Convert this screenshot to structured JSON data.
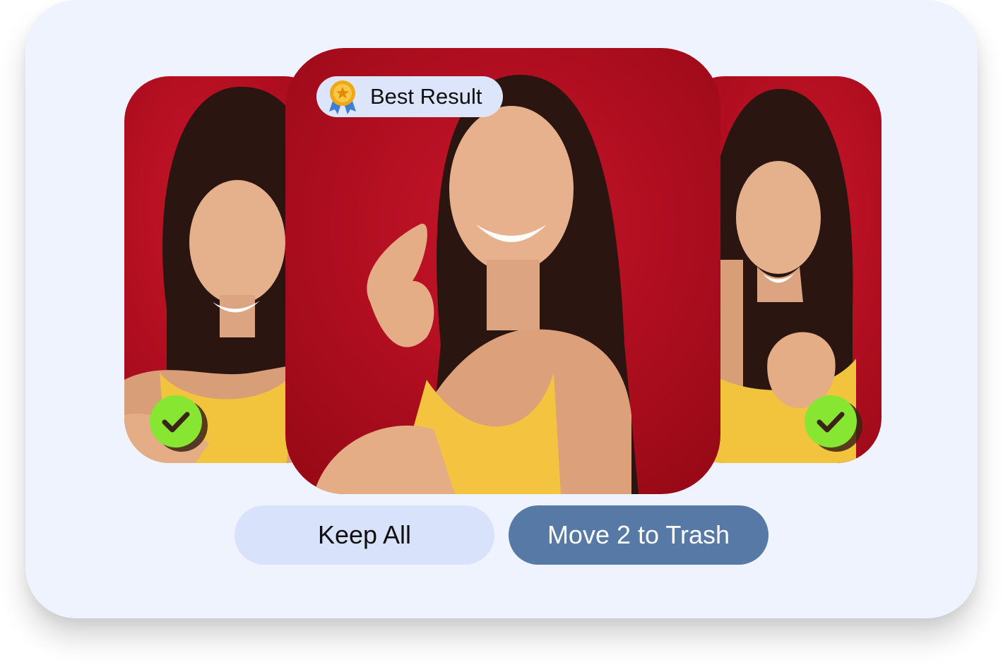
{
  "badge": {
    "label": "Best Result",
    "icon": "award-medal-icon"
  },
  "photos": [
    {
      "name": "left",
      "selected": true,
      "icon": "check-icon"
    },
    {
      "name": "center",
      "best": true
    },
    {
      "name": "right",
      "selected": true,
      "icon": "check-icon"
    }
  ],
  "actions": {
    "keep_label": "Keep All",
    "trash_label": "Move 2 to Trash"
  },
  "colors": {
    "card_bg": "#eff3fd",
    "photo_bg": "#b50d1e",
    "check_green": "#86e631",
    "badge_bg": "#dde5fb",
    "keep_bg": "#d9e2fb",
    "trash_bg": "#5679a6"
  }
}
